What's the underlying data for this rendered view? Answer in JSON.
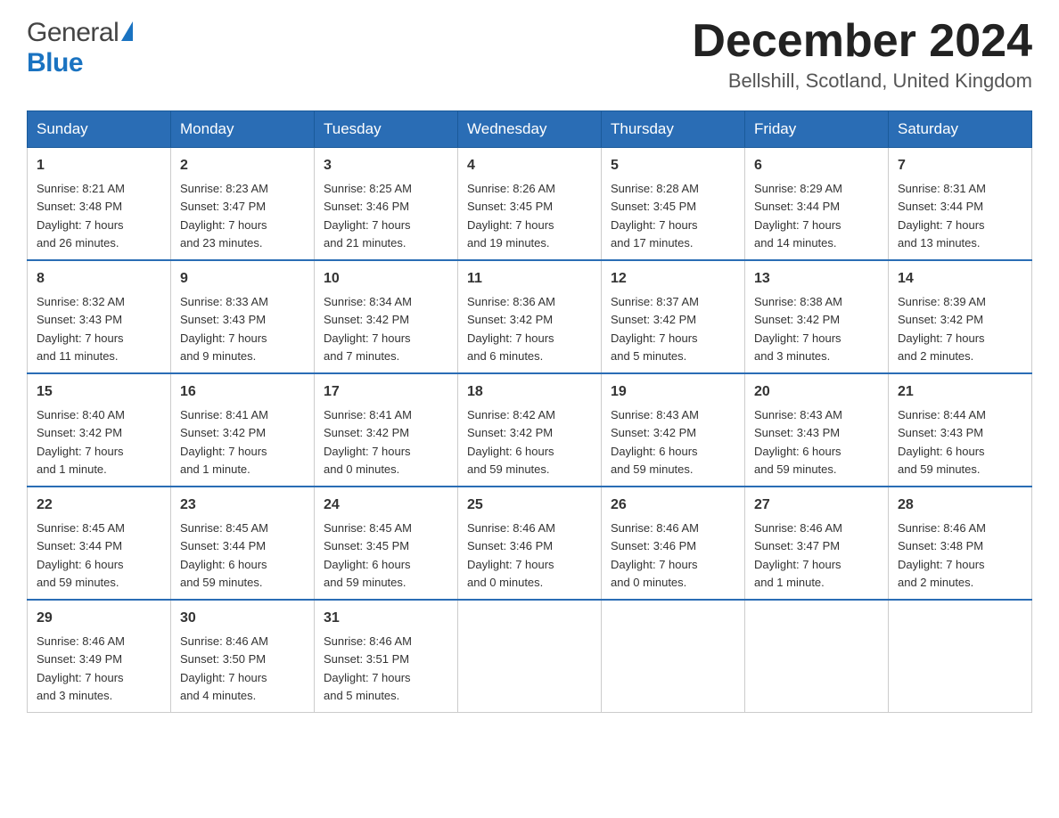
{
  "header": {
    "logo_general": "General",
    "logo_blue": "Blue",
    "title": "December 2024",
    "location": "Bellshill, Scotland, United Kingdom"
  },
  "calendar": {
    "days_of_week": [
      "Sunday",
      "Monday",
      "Tuesday",
      "Wednesday",
      "Thursday",
      "Friday",
      "Saturday"
    ],
    "weeks": [
      [
        {
          "day": "1",
          "sunrise": "Sunrise: 8:21 AM",
          "sunset": "Sunset: 3:48 PM",
          "daylight": "Daylight: 7 hours",
          "daylight2": "and 26 minutes."
        },
        {
          "day": "2",
          "sunrise": "Sunrise: 8:23 AM",
          "sunset": "Sunset: 3:47 PM",
          "daylight": "Daylight: 7 hours",
          "daylight2": "and 23 minutes."
        },
        {
          "day": "3",
          "sunrise": "Sunrise: 8:25 AM",
          "sunset": "Sunset: 3:46 PM",
          "daylight": "Daylight: 7 hours",
          "daylight2": "and 21 minutes."
        },
        {
          "day": "4",
          "sunrise": "Sunrise: 8:26 AM",
          "sunset": "Sunset: 3:45 PM",
          "daylight": "Daylight: 7 hours",
          "daylight2": "and 19 minutes."
        },
        {
          "day": "5",
          "sunrise": "Sunrise: 8:28 AM",
          "sunset": "Sunset: 3:45 PM",
          "daylight": "Daylight: 7 hours",
          "daylight2": "and 17 minutes."
        },
        {
          "day": "6",
          "sunrise": "Sunrise: 8:29 AM",
          "sunset": "Sunset: 3:44 PM",
          "daylight": "Daylight: 7 hours",
          "daylight2": "and 14 minutes."
        },
        {
          "day": "7",
          "sunrise": "Sunrise: 8:31 AM",
          "sunset": "Sunset: 3:44 PM",
          "daylight": "Daylight: 7 hours",
          "daylight2": "and 13 minutes."
        }
      ],
      [
        {
          "day": "8",
          "sunrise": "Sunrise: 8:32 AM",
          "sunset": "Sunset: 3:43 PM",
          "daylight": "Daylight: 7 hours",
          "daylight2": "and 11 minutes."
        },
        {
          "day": "9",
          "sunrise": "Sunrise: 8:33 AM",
          "sunset": "Sunset: 3:43 PM",
          "daylight": "Daylight: 7 hours",
          "daylight2": "and 9 minutes."
        },
        {
          "day": "10",
          "sunrise": "Sunrise: 8:34 AM",
          "sunset": "Sunset: 3:42 PM",
          "daylight": "Daylight: 7 hours",
          "daylight2": "and 7 minutes."
        },
        {
          "day": "11",
          "sunrise": "Sunrise: 8:36 AM",
          "sunset": "Sunset: 3:42 PM",
          "daylight": "Daylight: 7 hours",
          "daylight2": "and 6 minutes."
        },
        {
          "day": "12",
          "sunrise": "Sunrise: 8:37 AM",
          "sunset": "Sunset: 3:42 PM",
          "daylight": "Daylight: 7 hours",
          "daylight2": "and 5 minutes."
        },
        {
          "day": "13",
          "sunrise": "Sunrise: 8:38 AM",
          "sunset": "Sunset: 3:42 PM",
          "daylight": "Daylight: 7 hours",
          "daylight2": "and 3 minutes."
        },
        {
          "day": "14",
          "sunrise": "Sunrise: 8:39 AM",
          "sunset": "Sunset: 3:42 PM",
          "daylight": "Daylight: 7 hours",
          "daylight2": "and 2 minutes."
        }
      ],
      [
        {
          "day": "15",
          "sunrise": "Sunrise: 8:40 AM",
          "sunset": "Sunset: 3:42 PM",
          "daylight": "Daylight: 7 hours",
          "daylight2": "and 1 minute."
        },
        {
          "day": "16",
          "sunrise": "Sunrise: 8:41 AM",
          "sunset": "Sunset: 3:42 PM",
          "daylight": "Daylight: 7 hours",
          "daylight2": "and 1 minute."
        },
        {
          "day": "17",
          "sunrise": "Sunrise: 8:41 AM",
          "sunset": "Sunset: 3:42 PM",
          "daylight": "Daylight: 7 hours",
          "daylight2": "and 0 minutes."
        },
        {
          "day": "18",
          "sunrise": "Sunrise: 8:42 AM",
          "sunset": "Sunset: 3:42 PM",
          "daylight": "Daylight: 6 hours",
          "daylight2": "and 59 minutes."
        },
        {
          "day": "19",
          "sunrise": "Sunrise: 8:43 AM",
          "sunset": "Sunset: 3:42 PM",
          "daylight": "Daylight: 6 hours",
          "daylight2": "and 59 minutes."
        },
        {
          "day": "20",
          "sunrise": "Sunrise: 8:43 AM",
          "sunset": "Sunset: 3:43 PM",
          "daylight": "Daylight: 6 hours",
          "daylight2": "and 59 minutes."
        },
        {
          "day": "21",
          "sunrise": "Sunrise: 8:44 AM",
          "sunset": "Sunset: 3:43 PM",
          "daylight": "Daylight: 6 hours",
          "daylight2": "and 59 minutes."
        }
      ],
      [
        {
          "day": "22",
          "sunrise": "Sunrise: 8:45 AM",
          "sunset": "Sunset: 3:44 PM",
          "daylight": "Daylight: 6 hours",
          "daylight2": "and 59 minutes."
        },
        {
          "day": "23",
          "sunrise": "Sunrise: 8:45 AM",
          "sunset": "Sunset: 3:44 PM",
          "daylight": "Daylight: 6 hours",
          "daylight2": "and 59 minutes."
        },
        {
          "day": "24",
          "sunrise": "Sunrise: 8:45 AM",
          "sunset": "Sunset: 3:45 PM",
          "daylight": "Daylight: 6 hours",
          "daylight2": "and 59 minutes."
        },
        {
          "day": "25",
          "sunrise": "Sunrise: 8:46 AM",
          "sunset": "Sunset: 3:46 PM",
          "daylight": "Daylight: 7 hours",
          "daylight2": "and 0 minutes."
        },
        {
          "day": "26",
          "sunrise": "Sunrise: 8:46 AM",
          "sunset": "Sunset: 3:46 PM",
          "daylight": "Daylight: 7 hours",
          "daylight2": "and 0 minutes."
        },
        {
          "day": "27",
          "sunrise": "Sunrise: 8:46 AM",
          "sunset": "Sunset: 3:47 PM",
          "daylight": "Daylight: 7 hours",
          "daylight2": "and 1 minute."
        },
        {
          "day": "28",
          "sunrise": "Sunrise: 8:46 AM",
          "sunset": "Sunset: 3:48 PM",
          "daylight": "Daylight: 7 hours",
          "daylight2": "and 2 minutes."
        }
      ],
      [
        {
          "day": "29",
          "sunrise": "Sunrise: 8:46 AM",
          "sunset": "Sunset: 3:49 PM",
          "daylight": "Daylight: 7 hours",
          "daylight2": "and 3 minutes."
        },
        {
          "day": "30",
          "sunrise": "Sunrise: 8:46 AM",
          "sunset": "Sunset: 3:50 PM",
          "daylight": "Daylight: 7 hours",
          "daylight2": "and 4 minutes."
        },
        {
          "day": "31",
          "sunrise": "Sunrise: 8:46 AM",
          "sunset": "Sunset: 3:51 PM",
          "daylight": "Daylight: 7 hours",
          "daylight2": "and 5 minutes."
        },
        null,
        null,
        null,
        null
      ]
    ]
  }
}
